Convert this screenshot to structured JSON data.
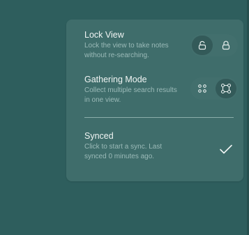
{
  "lock_view": {
    "title": "Lock View",
    "description": "Lock the view to take notes without re-searching.",
    "selected": "unlocked",
    "options": [
      "unlocked-icon",
      "locked-icon"
    ]
  },
  "gathering_mode": {
    "title": "Gathering Mode",
    "description": "Collect multiple search results in one view.",
    "selected": "connected",
    "options": [
      "separate-nodes-icon",
      "connected-nodes-icon"
    ]
  },
  "synced": {
    "title": "Synced",
    "description": "Click to start a sync. Last synced 0 minutes ago.",
    "status_icon": "check-icon"
  },
  "colors": {
    "background": "#2e5e5d",
    "panel": "#3f6d6b",
    "active_segment": "#335a59",
    "text_primary": "#f1f5f4",
    "text_secondary": "#9bbab8"
  }
}
